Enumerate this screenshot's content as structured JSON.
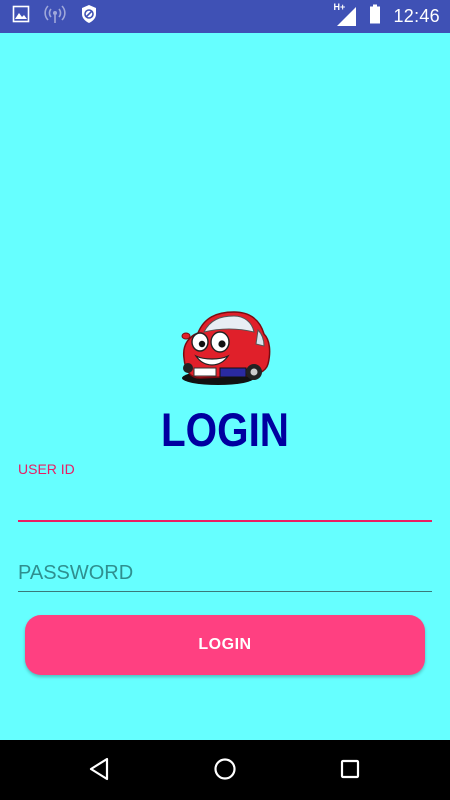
{
  "status_bar": {
    "time": "12:46",
    "icons": [
      "image-icon",
      "wifi-hotspot-icon",
      "blocked-icon",
      "hplus-signal-icon",
      "battery-icon"
    ],
    "network_label": "H+",
    "color": "#3F51B5"
  },
  "logo": {
    "icon": "cartoon-car-logo"
  },
  "title": "LOGIN",
  "form": {
    "user_id_label": "USER ID",
    "user_id_value": "",
    "password_placeholder": "PASSWORD",
    "password_value": ""
  },
  "login_button": {
    "label": "LOGIN",
    "color": "#FF4081"
  },
  "nav_bar": {
    "icons": [
      "back-icon",
      "home-icon",
      "recents-icon"
    ]
  },
  "colors": {
    "background": "#66FFFF",
    "accent": "#E91E63",
    "title": "#0000A0"
  }
}
